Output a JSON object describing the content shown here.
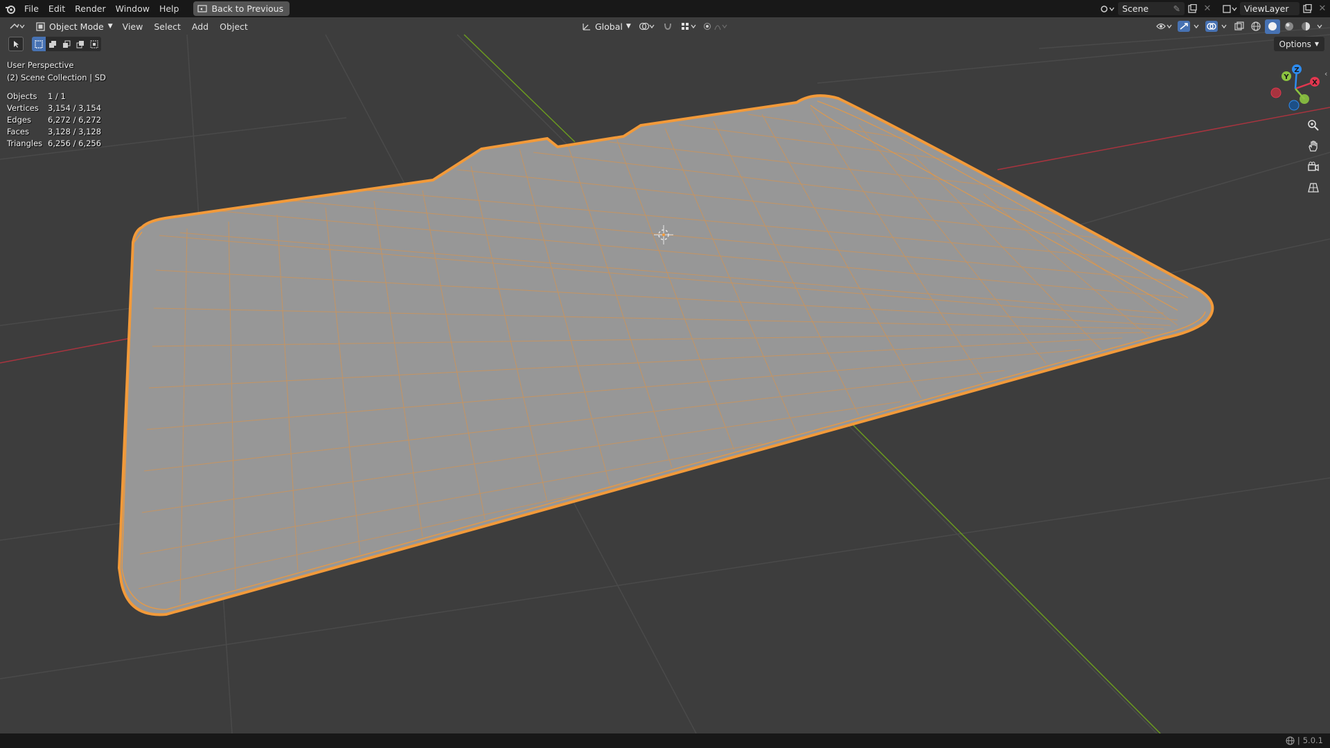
{
  "menubar": {
    "items": [
      "File",
      "Edit",
      "Render",
      "Window",
      "Help"
    ],
    "back_button": "Back to Previous",
    "scene_name": "Scene",
    "view_layer": "ViewLayer"
  },
  "viewport_header": {
    "mode": "Object Mode",
    "menus": [
      "View",
      "Select",
      "Add",
      "Object"
    ],
    "transform_orientation": "Global",
    "options_label": "Options"
  },
  "overlay": {
    "perspective": "User Perspective",
    "collection": "(2) Scene Collection | SD"
  },
  "stats": [
    {
      "label": "Objects",
      "value": "1 / 1"
    },
    {
      "label": "Vertices",
      "value": "3,154 / 3,154"
    },
    {
      "label": "Edges",
      "value": "6,272 / 6,272"
    },
    {
      "label": "Faces",
      "value": "3,128 / 3,128"
    },
    {
      "label": "Triangles",
      "value": "6,256 / 6,256"
    }
  ],
  "gizmo": {
    "x_label": "X",
    "y_label": "Y",
    "z_label": "Z",
    "colors": {
      "x": "#e2374f",
      "y": "#8bc340",
      "z": "#2e8cf0"
    }
  },
  "statusbar": {
    "version": "5.0.1"
  },
  "colors": {
    "selection_outline": "#f29a3a",
    "mesh_fill": "#9a9a9a",
    "background": "#3d3d3d",
    "x_axis": "#a8343f",
    "y_axis": "#6b9b1f"
  }
}
